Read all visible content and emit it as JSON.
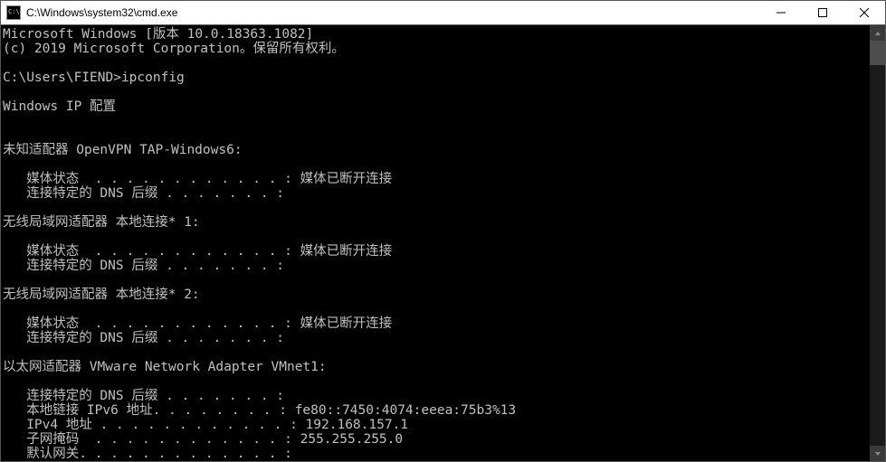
{
  "window": {
    "title": "C:\\Windows\\system32\\cmd.exe"
  },
  "terminal": {
    "lines": [
      "Microsoft Windows [版本 10.0.18363.1082]",
      "(c) 2019 Microsoft Corporation。保留所有权利。",
      "",
      "C:\\Users\\FIEND>ipconfig",
      "",
      "Windows IP 配置",
      "",
      "",
      "未知适配器 OpenVPN TAP-Windows6:",
      "",
      "   媒体状态  . . . . . . . . . . . . : 媒体已断开连接",
      "   连接特定的 DNS 后缀 . . . . . . . :",
      "",
      "无线局域网适配器 本地连接* 1:",
      "",
      "   媒体状态  . . . . . . . . . . . . : 媒体已断开连接",
      "   连接特定的 DNS 后缀 . . . . . . . :",
      "",
      "无线局域网适配器 本地连接* 2:",
      "",
      "   媒体状态  . . . . . . . . . . . . : 媒体已断开连接",
      "   连接特定的 DNS 后缀 . . . . . . . :",
      "",
      "以太网适配器 VMware Network Adapter VMnet1:",
      "",
      "   连接特定的 DNS 后缀 . . . . . . . :",
      "   本地链接 IPv6 地址. . . . . . . . : fe80::7450:4074:eeea:75b3%13",
      "   IPv4 地址 . . . . . . . . . . . . : 192.168.157.1",
      "   子网掩码  . . . . . . . . . . . . : 255.255.255.0",
      "   默认网关. . . . . . . . . . . . . :"
    ]
  },
  "scrollbar": {
    "thumb_top_pct": 0,
    "thumb_height_pct": 6
  }
}
